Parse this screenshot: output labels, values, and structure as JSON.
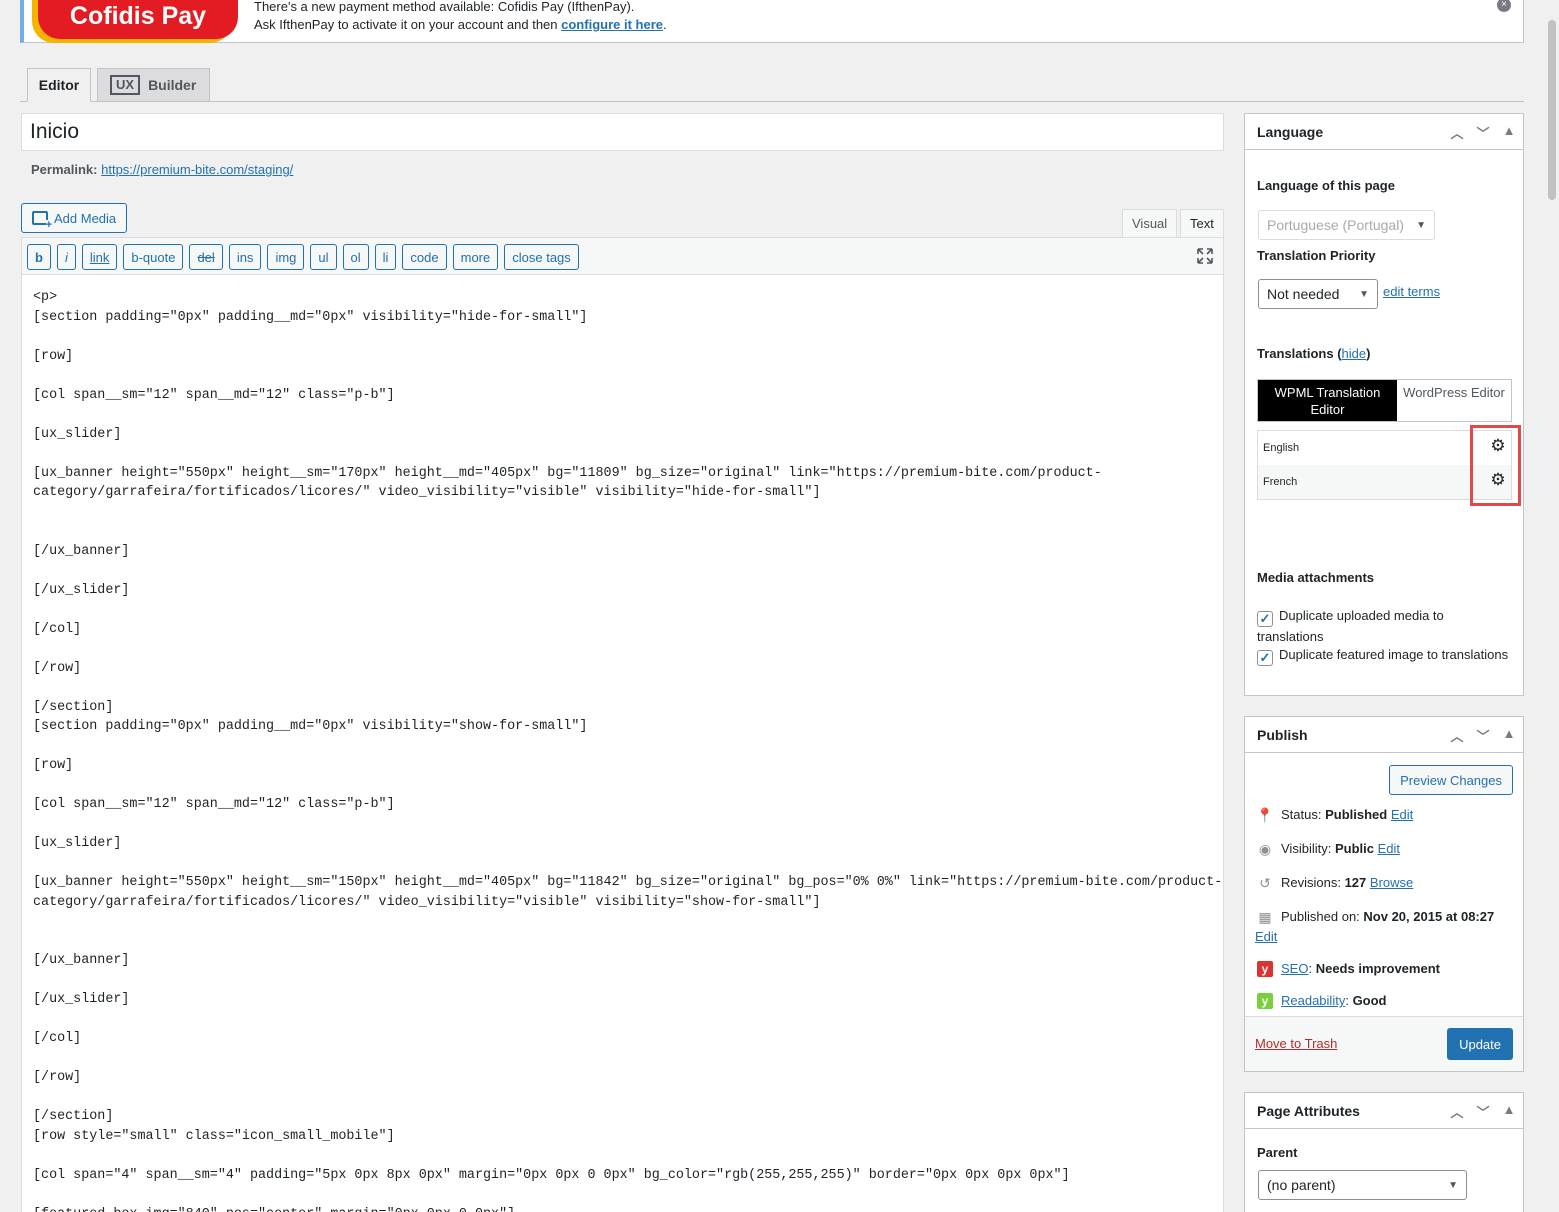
{
  "notice": {
    "logo_text": "Cofidis Pay",
    "line1": "There's a new payment method available: Cofidis Pay (IfthenPay).",
    "line2_prefix": "Ask IfthenPay to activate it on your account and then ",
    "line2_link": "configure it here",
    "line2_suffix": ".",
    "dismiss": "×"
  },
  "tabs": {
    "editor": "Editor",
    "ux_badge": "UX",
    "ux_label": "Builder"
  },
  "post": {
    "title": "Inicio",
    "permalink_label": "Permalink:",
    "permalink_url": "https://premium-bite.com/staging/"
  },
  "toolbar": {
    "add_media": "Add Media",
    "visual": "Visual",
    "text": "Text",
    "buttons": [
      "b",
      "i",
      "link",
      "b-quote",
      "del",
      "ins",
      "img",
      "ul",
      "ol",
      "li",
      "code",
      "more",
      "close tags"
    ]
  },
  "editor_content": "<p>\n[section padding=\"0px\" padding__md=\"0px\" visibility=\"hide-for-small\"]\n\n[row]\n\n[col span__sm=\"12\" span__md=\"12\" class=\"p-b\"]\n\n[ux_slider]\n\n[ux_banner height=\"550px\" height__sm=\"170px\" height__md=\"405px\" bg=\"11809\" bg_size=\"original\" link=\"https://premium-bite.com/product-\ncategory/garrafeira/fortificados/licores/\" video_visibility=\"visible\" visibility=\"hide-for-small\"]\n\n\n[/ux_banner]\n\n[/ux_slider]\n\n[/col]\n\n[/row]\n\n[/section]\n[section padding=\"0px\" padding__md=\"0px\" visibility=\"show-for-small\"]\n\n[row]\n\n[col span__sm=\"12\" span__md=\"12\" class=\"p-b\"]\n\n[ux_slider]\n\n[ux_banner height=\"550px\" height__sm=\"150px\" height__md=\"405px\" bg=\"11842\" bg_size=\"original\" bg_pos=\"0% 0%\" link=\"https://premium-bite.com/product-\ncategory/garrafeira/fortificados/licores/\" video_visibility=\"visible\" visibility=\"show-for-small\"]\n\n\n[/ux_banner]\n\n[/ux_slider]\n\n[/col]\n\n[/row]\n\n[/section]\n[row style=\"small\" class=\"icon_small_mobile\"]\n\n[col span=\"4\" span__sm=\"4\" padding=\"5px 0px 8px 0px\" margin=\"0px 0px 0 0px\" bg_color=\"rgb(255,255,255)\" border=\"0px 0px 0px 0px\"]\n\n[featured_box img=\"840\" pos=\"center\" margin=\"0px 0px 0 0px\"]",
  "language_box": {
    "title": "Language",
    "lang_of_page_label": "Language of this page",
    "lang_of_page_value": "Portuguese (Portugal)",
    "priority_label": "Translation Priority",
    "priority_value": "Not needed",
    "edit_terms": "edit terms",
    "translations_label": "Translations (",
    "translations_hide": "hide",
    "translations_close": ")",
    "wpml_editor": "WPML Translation Editor",
    "wp_editor": "WordPress Editor",
    "languages": [
      "English",
      "French"
    ],
    "media_label": "Media attachments",
    "dup_media": "Duplicate uploaded media to translations",
    "dup_featured": "Duplicate featured image to translations"
  },
  "publish_box": {
    "title": "Publish",
    "preview": "Preview Changes",
    "status_label": "Status: ",
    "status_value": "Published",
    "visibility_label": "Visibility: ",
    "visibility_value": "Public",
    "revisions_label": "Revisions: ",
    "revisions_value": "127",
    "browse": "Browse",
    "published_label": "Published on: ",
    "published_value": "Nov 20, 2015 at 08:27",
    "edit": "Edit",
    "seo_link": "SEO",
    "seo_value": "Needs improvement",
    "readability_link": "Readability",
    "readability_value": "Good",
    "trash": "Move to Trash",
    "update": "Update"
  },
  "attributes_box": {
    "title": "Page Attributes",
    "parent_label": "Parent",
    "parent_value": "(no parent)"
  },
  "colors": {
    "accent": "#2271b1",
    "highlight": "#e14a4a",
    "seo_bad": "#dc3232",
    "seo_good": "#7ad03a"
  }
}
